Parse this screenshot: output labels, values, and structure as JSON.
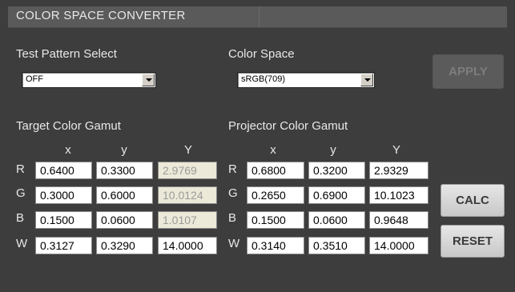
{
  "title": "COLOR SPACE CONVERTER",
  "test_pattern": {
    "label": "Test Pattern Select",
    "value": "OFF"
  },
  "color_space": {
    "label": "Color Space",
    "value": "sRGB(709)"
  },
  "buttons": {
    "apply": "APPLY",
    "calc": "CALC",
    "reset": "RESET"
  },
  "target": {
    "label": "Target Color Gamut",
    "headers": [
      "x",
      "y",
      "Y"
    ],
    "rows": [
      {
        "name": "R",
        "x": "0.6400",
        "y": "0.3300",
        "Y": "2.9769"
      },
      {
        "name": "G",
        "x": "0.3000",
        "y": "0.6000",
        "Y": "10.0124"
      },
      {
        "name": "B",
        "x": "0.1500",
        "y": "0.0600",
        "Y": "1.0107"
      },
      {
        "name": "W",
        "x": "0.3127",
        "y": "0.3290",
        "Y": "14.0000"
      }
    ]
  },
  "projector": {
    "label": "Projector Color Gamut",
    "headers": [
      "x",
      "y",
      "Y"
    ],
    "rows": [
      {
        "name": "R",
        "x": "0.6800",
        "y": "0.3200",
        "Y": "2.9329"
      },
      {
        "name": "G",
        "x": "0.2650",
        "y": "0.6900",
        "Y": "10.1023"
      },
      {
        "name": "B",
        "x": "0.1500",
        "y": "0.0600",
        "Y": "0.9648"
      },
      {
        "name": "W",
        "x": "0.3140",
        "y": "0.3510",
        "Y": "14.0000"
      }
    ]
  }
}
